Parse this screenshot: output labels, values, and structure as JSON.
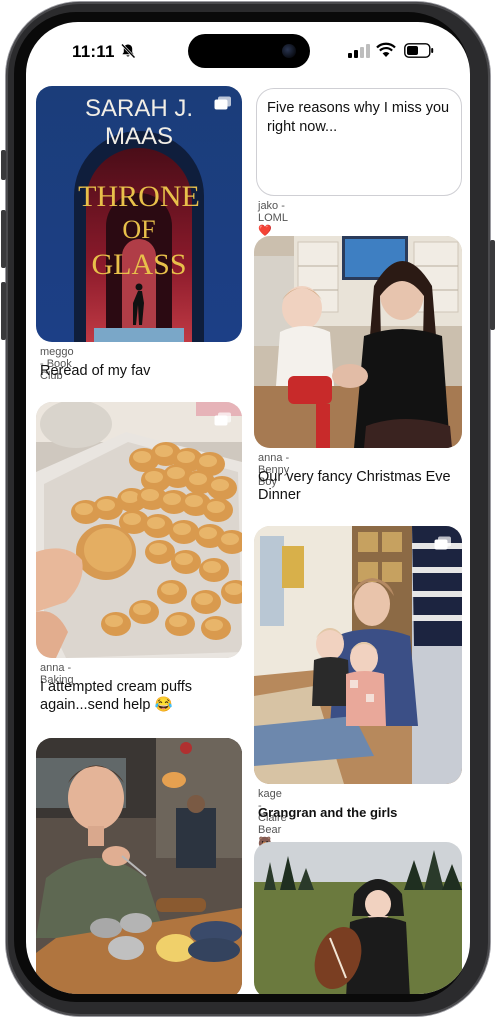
{
  "status_bar": {
    "time": "11:11"
  },
  "posts": [
    {
      "id": "book",
      "author_line": "meggo - Book Club",
      "caption": "Reread of my fav",
      "cover_text": [
        "SARAH J.",
        "MAAS",
        "THRONE",
        "OF",
        "GLASS"
      ],
      "multi_image": true
    },
    {
      "id": "text",
      "text": "Five reasons why I miss you right now...",
      "author_line": "jako - LOML ❤️"
    },
    {
      "id": "christmas",
      "author_line": "anna - Benny Boy",
      "caption": "Our very fancy Christmas Eve Dinner"
    },
    {
      "id": "baking",
      "author_line": "anna - Baking",
      "caption": "I attempted cream puffs again...send help 😂",
      "multi_image": true
    },
    {
      "id": "grangran",
      "author_line": "kage - Claire Bear 🐻",
      "caption": "Grangran and the girls",
      "multi_image": true
    },
    {
      "id": "dinner",
      "author_line": "",
      "caption": ""
    },
    {
      "id": "football",
      "author_line": "",
      "caption": ""
    }
  ],
  "colors": {
    "screen_bg": "#ffffff",
    "text_primary": "#111111",
    "text_secondary": "#555555",
    "card_border": "#cfcfd4"
  }
}
